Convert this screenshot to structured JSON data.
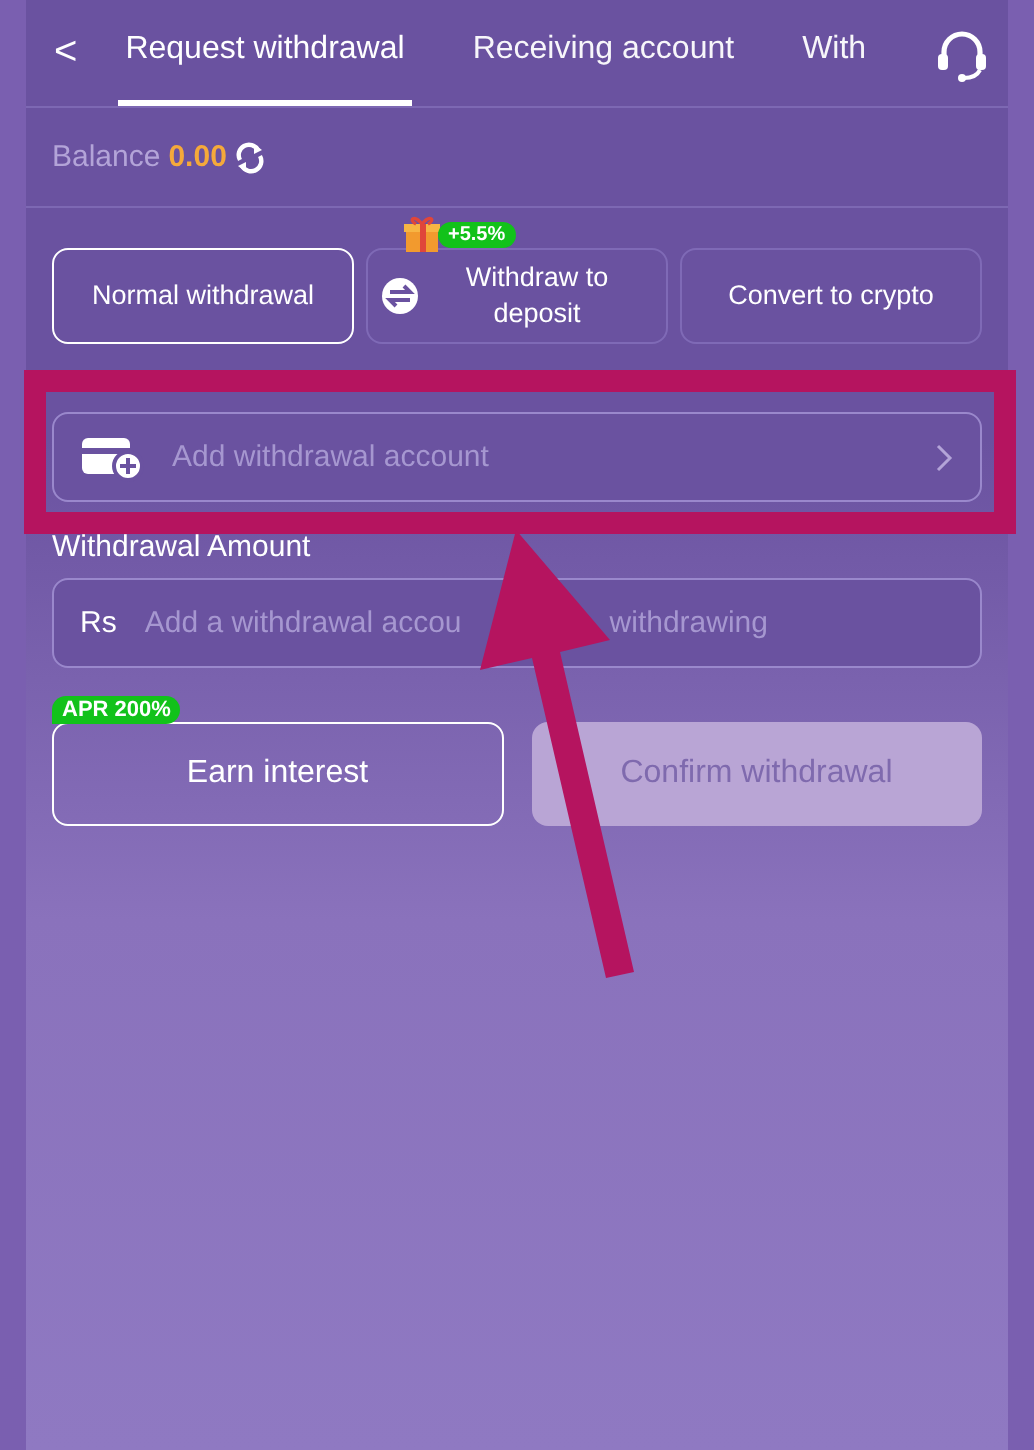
{
  "header": {
    "back": "<",
    "tabs": [
      {
        "label": "Request withdrawal",
        "selected": true
      },
      {
        "label": "Receiving account",
        "selected": false
      },
      {
        "label": "With",
        "selected": false
      }
    ]
  },
  "balance": {
    "label": "Balance",
    "amount": "0.00"
  },
  "methods": [
    {
      "label": "Normal withdrawal",
      "selected": true,
      "kind": "plain"
    },
    {
      "label": "Withdraw to deposit",
      "selected": false,
      "kind": "bonus",
      "badge": "+5.5%"
    },
    {
      "label": "Convert to crypto",
      "selected": false,
      "kind": "plain"
    }
  ],
  "account": {
    "placeholder": "Add withdrawal account"
  },
  "amount": {
    "label": "Withdrawal Amount",
    "currency": "Rs",
    "placeholder": [
      "Add a withdrawal accou",
      "withdrawing"
    ]
  },
  "actions": [
    {
      "label": "Earn interest",
      "badge": "APR 200%",
      "disabled": false
    },
    {
      "label": "Confirm withdrawal",
      "disabled": true
    }
  ]
}
